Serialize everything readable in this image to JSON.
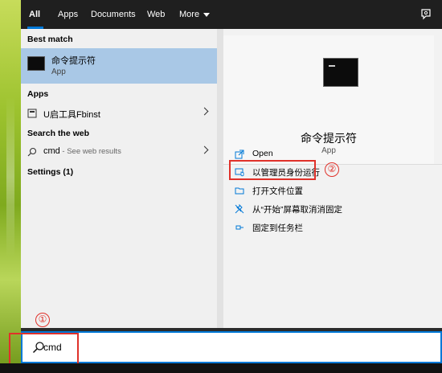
{
  "tabs": [
    {
      "label": "All",
      "active": true
    },
    {
      "label": "Apps"
    },
    {
      "label": "Documents"
    },
    {
      "label": "Web"
    },
    {
      "label": "More"
    }
  ],
  "left": {
    "best_match_heading": "Best match",
    "best_match": {
      "title": "命令提示符",
      "subtitle": "App",
      "icon": "command-prompt-icon"
    },
    "apps_heading": "Apps",
    "apps": [
      {
        "label": "U启工具Fbinst",
        "icon": "app-icon"
      }
    ],
    "web_heading": "Search the web",
    "web_result": {
      "query": "cmd",
      "hint": " - See web results",
      "icon": "search-icon"
    },
    "settings_heading": "Settings (1)"
  },
  "preview": {
    "title": "命令提示符",
    "subtitle": "App",
    "actions": [
      {
        "label": "Open",
        "icon": "open-icon"
      },
      {
        "label": "以管理员身份运行",
        "icon": "run-as-admin-icon"
      },
      {
        "label": "打开文件位置",
        "icon": "folder-icon"
      },
      {
        "label": "从“开始”屏幕取消消固定",
        "icon": "unpin-icon"
      },
      {
        "label": "固定到任务栏",
        "icon": "pin-icon"
      }
    ]
  },
  "annotations": {
    "step1": "①",
    "step2": "②"
  },
  "search": {
    "value": "cmd"
  },
  "colors": {
    "accent": "#0078d7",
    "selection": "#a9c8e6",
    "annotation": "#e0312a"
  }
}
